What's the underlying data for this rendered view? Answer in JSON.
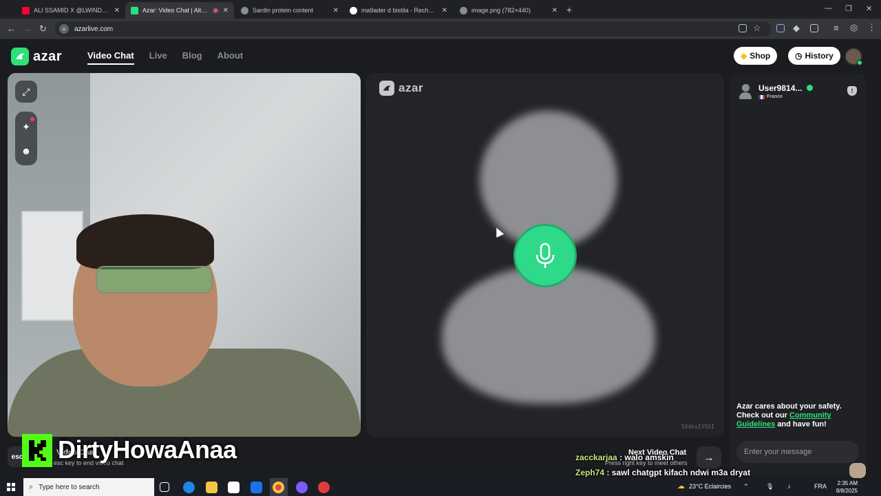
{
  "browser": {
    "tabs": [
      {
        "label": "ALI SSAMID X @LWINDofficiel",
        "favicon_color": "#ff0033",
        "active": false
      },
      {
        "label": "Azar: Video Chat | Alternati",
        "favicon_color": "#2ee07a",
        "active": true
      },
      {
        "label": "Sardin protein content",
        "favicon_color": "#8a8d92",
        "active": false
      },
      {
        "label": "ma9ader d bistila - Recherche G",
        "favicon_color": "#ffffff",
        "active": false
      },
      {
        "label": "image.png (782×440)",
        "favicon_color": "#8a8d92",
        "active": false
      }
    ],
    "url": "azarlive.com"
  },
  "header": {
    "logo": "azar",
    "nav": [
      {
        "label": "Video Chat",
        "active": true
      },
      {
        "label": "Live",
        "active": false
      },
      {
        "label": "Blog",
        "active": false
      },
      {
        "label": "About",
        "active": false
      }
    ],
    "shop_label": "Shop",
    "history_label": "History"
  },
  "video": {
    "partner_logo": "azar",
    "partner_id": "5X4hs1YSSI"
  },
  "chat": {
    "user_name": "User9814...",
    "user_country": "France",
    "safety_line1": "Azar cares about your safety.",
    "safety_line2": "Check out our",
    "safety_link": "Community Guidelines",
    "safety_line3": "and have fun!",
    "input_placeholder": "Enter your message"
  },
  "controls": {
    "esc_label": "esc",
    "stop_title": "Video Chat",
    "stop_sub": "esc key to end video chat",
    "next_title": "Next Video Chat",
    "next_sub": "Press right key to meet others"
  },
  "stream_overlay": {
    "streamer_name": "DirtyHowaAnaa",
    "messages": [
      {
        "user": "zacckarjaa",
        "text": ": walo amskin"
      },
      {
        "user": "Zeph74",
        "text": ": sawl chatgpt kifach ndwi m3a dryat"
      }
    ]
  },
  "taskbar": {
    "search_placeholder": "Type here to search",
    "weather": "23°C  Eclaircies",
    "language": "FRA",
    "time": "2:35 AM",
    "date": "8/8/2025"
  },
  "colors": {
    "accent": "#2ee07a",
    "background": "#1b1c1f"
  }
}
